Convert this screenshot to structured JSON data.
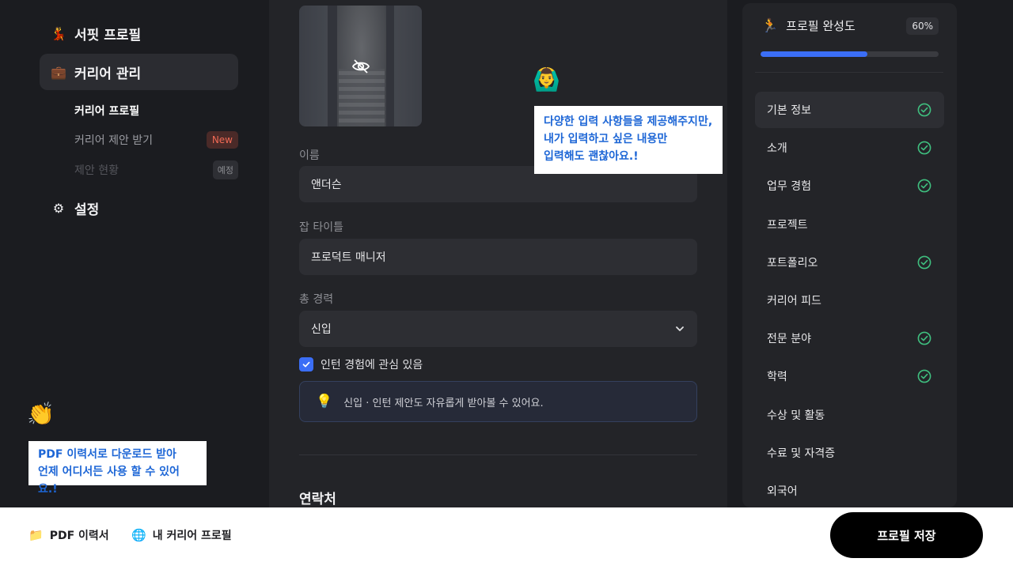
{
  "sidebar": {
    "main_items": [
      {
        "label": "서핏 프로필",
        "icon": "dancer-icon"
      },
      {
        "label": "커리어 관리",
        "icon": "briefcase-icon"
      },
      {
        "label": "설정",
        "icon": "gear-icon"
      }
    ],
    "sub_items": [
      {
        "label": "커리어 프로필"
      },
      {
        "label": "커리어 제안 받기",
        "badge": "New"
      },
      {
        "label": "제안 현황",
        "badge": "예정"
      }
    ]
  },
  "tooltips": {
    "left_line1": "PDF 이력서로 다운로드 받아",
    "left_line2": "언제 어디서든 사용 할 수 있어요.!",
    "mid_line1": "다양한 입력 사항들을 제공해주지만,",
    "mid_line2": "내가 입력하고 싶은 내용만",
    "mid_line3": "입력해도 괜찮아요.!"
  },
  "form": {
    "name_label": "이름",
    "name_value": "앤더슨",
    "job_label": "잡 타이틀",
    "job_value": "프로덕트 매니저",
    "career_label": "총 경력",
    "career_value": "신입",
    "intern_checkbox_label": "인턴 경험에 관심 있음",
    "intern_checked": true,
    "info_text": "신입 · 인턴 제안도 자유롭게 받아볼 수 있어요.",
    "contact_section_title": "연락처"
  },
  "completion": {
    "title": "프로필 완성도",
    "percent_label": "60%",
    "percent": 60,
    "sections": [
      {
        "label": "기본 정보",
        "done": true
      },
      {
        "label": "소개",
        "done": true
      },
      {
        "label": "업무 경험",
        "done": true
      },
      {
        "label": "프로젝트",
        "done": false
      },
      {
        "label": "포트폴리오",
        "done": true
      },
      {
        "label": "커리어 피드",
        "done": false
      },
      {
        "label": "전문 분야",
        "done": true
      },
      {
        "label": "학력",
        "done": true
      },
      {
        "label": "수상 및 활동",
        "done": false
      },
      {
        "label": "수료 및 자격증",
        "done": false
      },
      {
        "label": "외국어",
        "done": false
      }
    ]
  },
  "footer": {
    "pdf_label": "PDF 이력서",
    "profile_label": "내 커리어 프로필",
    "save_label": "프로필 저장"
  },
  "colors": {
    "accent": "#3b6ef6",
    "check_green": "#3fbf7f",
    "new_badge": "#f06a55",
    "tooltip_text": "#1d66d6"
  }
}
